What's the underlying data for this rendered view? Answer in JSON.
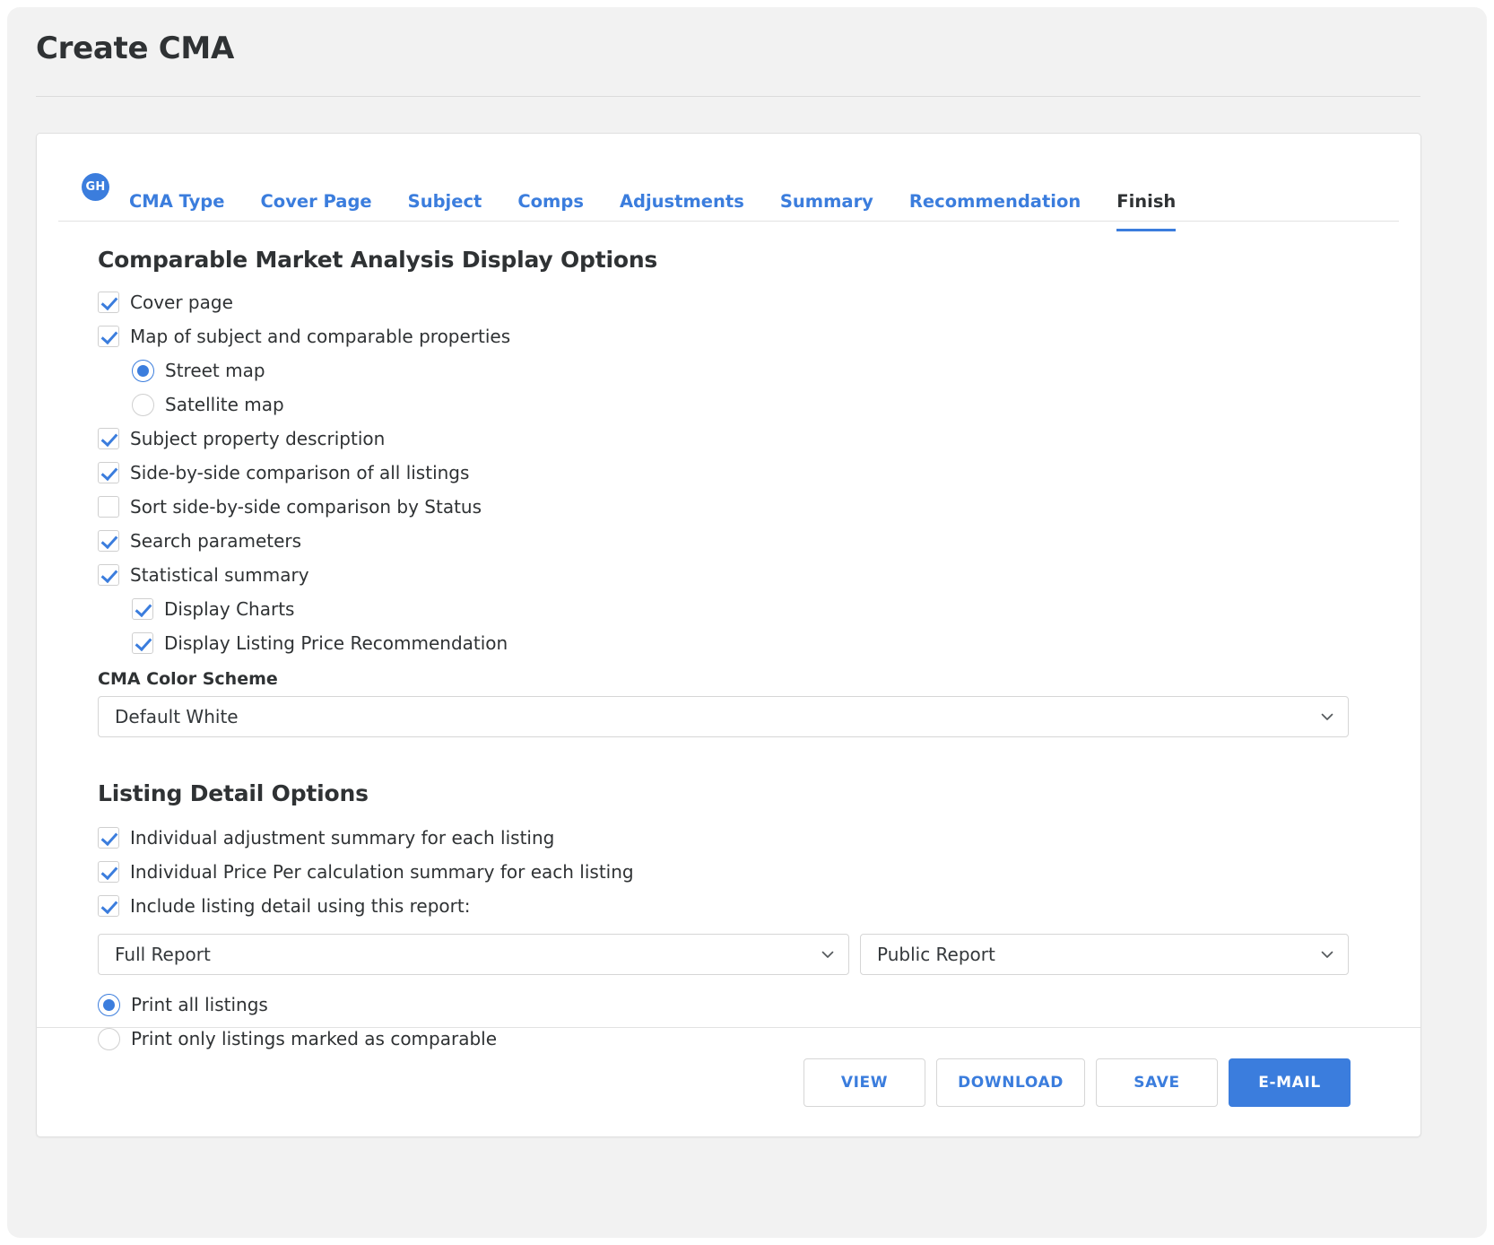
{
  "page": {
    "title": "Create CMA"
  },
  "user": {
    "initials": "GH"
  },
  "tabs": [
    {
      "label": "CMA Type",
      "active": false
    },
    {
      "label": "Cover Page",
      "active": false
    },
    {
      "label": "Subject",
      "active": false
    },
    {
      "label": "Comps",
      "active": false
    },
    {
      "label": "Adjustments",
      "active": false
    },
    {
      "label": "Summary",
      "active": false
    },
    {
      "label": "Recommendation",
      "active": false
    },
    {
      "label": "Finish",
      "active": true
    }
  ],
  "display_options": {
    "heading": "Comparable Market Analysis Display Options",
    "items": [
      {
        "label": "Cover page",
        "checked": true
      },
      {
        "label": "Map of subject and comparable properties",
        "checked": true
      }
    ],
    "map_type": {
      "street": {
        "label": "Street map",
        "selected": true
      },
      "satellite": {
        "label": "Satellite map",
        "selected": false
      }
    },
    "items2": [
      {
        "label": "Subject property description",
        "checked": true
      },
      {
        "label": "Side-by-side comparison of all listings",
        "checked": true
      },
      {
        "label": "Sort side-by-side comparison by Status",
        "checked": false
      },
      {
        "label": "Search parameters",
        "checked": true
      },
      {
        "label": "Statistical summary",
        "checked": true
      }
    ],
    "sub_items": [
      {
        "label": "Display Charts",
        "checked": true
      },
      {
        "label": "Display Listing Price Recommendation",
        "checked": true
      }
    ],
    "color_scheme": {
      "label": "CMA Color Scheme",
      "value": "Default White"
    }
  },
  "listing_detail": {
    "heading": "Listing Detail Options",
    "items": [
      {
        "label": "Individual adjustment summary for each listing",
        "checked": true
      },
      {
        "label": "Individual Price Per calculation summary for each listing",
        "checked": true
      },
      {
        "label": "Include listing detail using this report:",
        "checked": true
      }
    ],
    "report_select": "Full Report",
    "report_type_select": "Public Report",
    "print_scope": {
      "all": {
        "label": "Print all listings",
        "selected": true
      },
      "comparable": {
        "label": "Print only listings marked as comparable",
        "selected": false
      }
    }
  },
  "footer": {
    "view": "VIEW",
    "download": "DOWNLOAD",
    "save": "SAVE",
    "email": "E-MAIL"
  },
  "colors": {
    "accent": "#3b7ddd",
    "text": "#2f3234",
    "border": "#d6d6d6",
    "page_bg": "#f2f2f2"
  }
}
